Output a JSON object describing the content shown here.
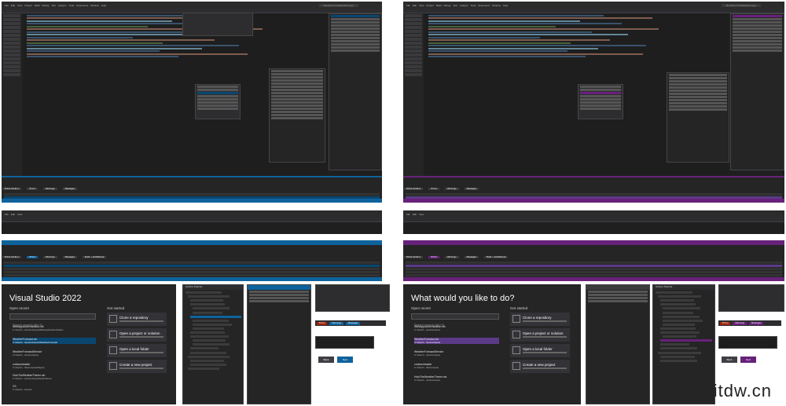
{
  "menu": [
    "File",
    "Edit",
    "View",
    "Project",
    "Build",
    "Debug",
    "Test",
    "Analyze",
    "Tools",
    "Extensions",
    "Window",
    "Help"
  ],
  "window_title": "MarathonTheWeatherApp",
  "start_left": {
    "title": "Visual Studio 2022",
    "open_recent": "Open recent",
    "get_started": "Get started",
    "search_placeholder": "Search recent (Alt+S)",
    "recent": [
      {
        "name": "WebAppAuthentication.sln",
        "path": "C:\\Users\\...\\source\\repos\\WebAppAuthentication"
      },
      {
        "name": "WeatherForecast.sln",
        "path": "C:\\Users\\...\\source\\repos\\WeatherForecast"
      },
      {
        "name": "WeatherForecastService",
        "path": "C:\\Users\\...\\source\\repos"
      },
      {
        "name": "contosoheader",
        "path": "C:\\Users\\...\\Documents\\Repos"
      },
      {
        "name": "HoloTheWeatherTheme.sln",
        "path": "C:\\Users\\...\\source\\repos\\HoloTheme"
      },
      {
        "name": "VS",
        "path": "C:\\Users\\...\\source"
      }
    ],
    "actions": [
      "Clone a repository",
      "Open a project or solution",
      "Open a local folder",
      "Create a new project"
    ]
  },
  "start_right": {
    "title": "What would you like to do?",
    "open_recent": "Open recent",
    "get_started": "Get started",
    "search_placeholder": "Search recent (Alt+S)",
    "recent": [
      {
        "name": "WebAppAuthentication.sln",
        "path": "C:\\Users\\...\\source\\repos"
      },
      {
        "name": "WeatherForecast.sln",
        "path": "C:\\Users\\...\\source\\repos"
      },
      {
        "name": "WeatherForecastService",
        "path": "C:\\Users\\...\\source\\repos"
      },
      {
        "name": "contosoheader",
        "path": "C:\\Users\\...\\Documents"
      },
      {
        "name": "HoloTheWeatherTheme.sln",
        "path": "C:\\Users\\...\\source\\repos"
      }
    ],
    "actions": [
      "Clone a repository",
      "Open a project or solution",
      "Open a local folder",
      "Create a new project"
    ]
  },
  "error_list": {
    "tabs": [
      "Entire Solution",
      "Errors",
      "Warnings",
      "Messages",
      "Build + IntelliSense"
    ],
    "title": "Error List"
  },
  "solution_explorer": {
    "title": "Solution Explorer"
  },
  "dialog_buttons": {
    "back": "Back",
    "next": "Next"
  },
  "filter_chips": [
    "Errors",
    "Warnings",
    "Messages"
  ],
  "watermark": "itdw.cn",
  "colors": {
    "accent_blue": "#0e639c",
    "accent_purple": "#68217a"
  }
}
